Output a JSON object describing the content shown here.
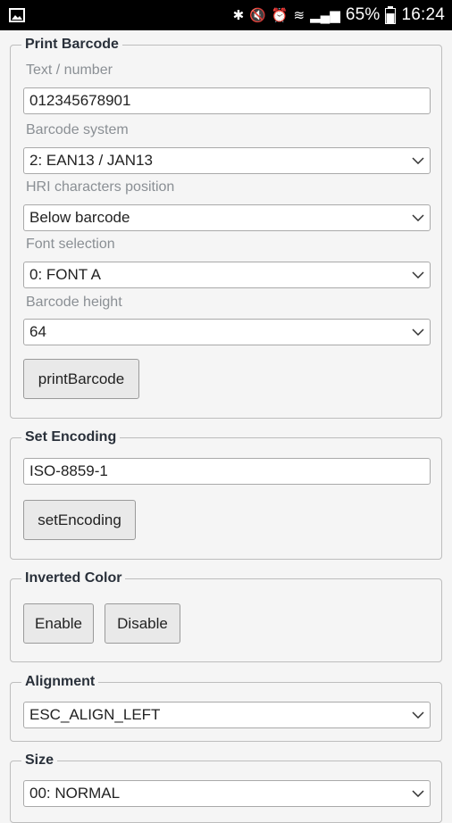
{
  "status_bar": {
    "battery_percent": "65%",
    "time": "16:24",
    "icons": [
      "image-icon",
      "bluetooth-icon",
      "mute-icon",
      "alarm-icon",
      "wifi-icon",
      "signal-icon",
      "battery-icon"
    ]
  },
  "print_barcode": {
    "legend": "Print Barcode",
    "text_label": "Text / number",
    "text_value": "012345678901",
    "system_label": "Barcode system",
    "system_value": "2: EAN13 / JAN13",
    "hri_label": "HRI characters position",
    "hri_value": "Below barcode",
    "font_label": "Font selection",
    "font_value": "0: FONT A",
    "height_label": "Barcode height",
    "height_value": "64",
    "button": "printBarcode"
  },
  "set_encoding": {
    "legend": "Set Encoding",
    "value": "ISO-8859-1",
    "button": "setEncoding"
  },
  "inverted_color": {
    "legend": "Inverted Color",
    "enable": "Enable",
    "disable": "Disable"
  },
  "alignment": {
    "legend": "Alignment",
    "value": "ESC_ALIGN_LEFT"
  },
  "size": {
    "legend": "Size",
    "value": "00: NORMAL"
  }
}
